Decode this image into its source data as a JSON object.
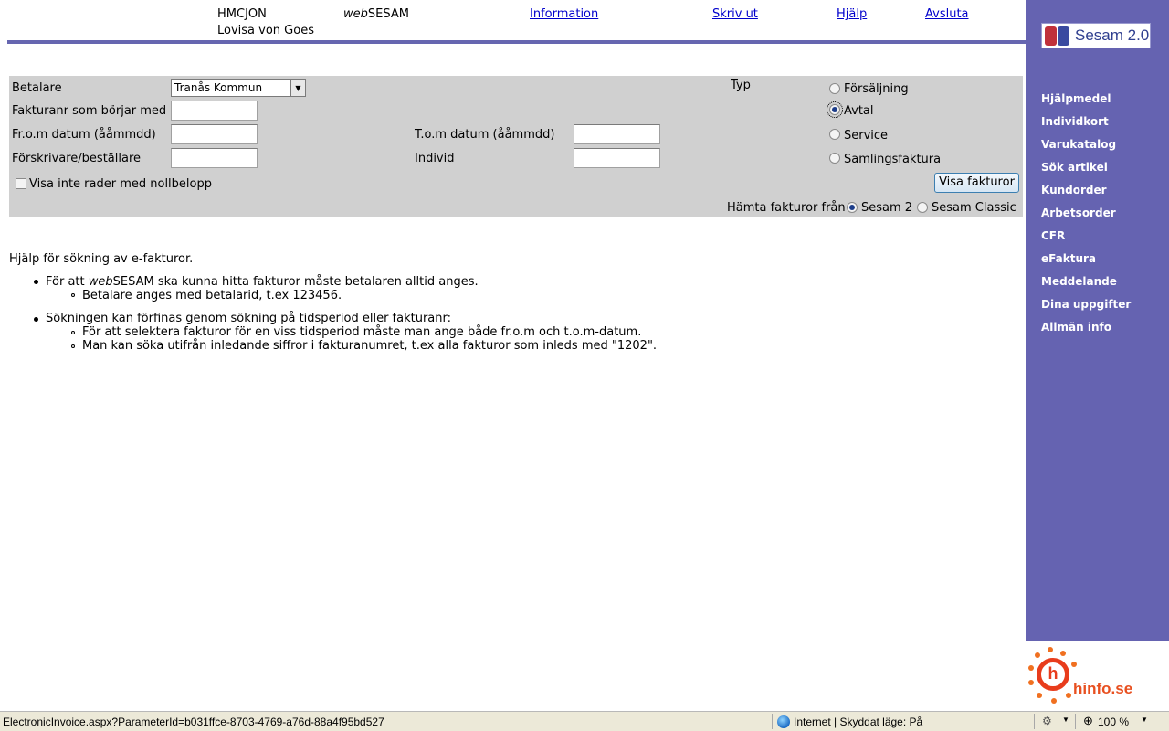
{
  "header": {
    "user_id": "HMCJON",
    "user_name": "Lovisa von Goes",
    "app_name_prefix": "web",
    "app_name_suffix": "SESAM",
    "links": {
      "information": "Information",
      "print": "Skriv ut",
      "help": "Hjälp",
      "logout": "Avsluta"
    }
  },
  "sidebar": {
    "logo_text": "Sesam 2.0",
    "items": [
      {
        "label": "Hjälpmedel"
      },
      {
        "label": "Individkort"
      },
      {
        "label": "Varukatalog"
      },
      {
        "label": "Sök artikel"
      },
      {
        "label": "Kundorder"
      },
      {
        "label": "Arbetsorder"
      },
      {
        "label": "CFR"
      },
      {
        "label": "eFaktura"
      },
      {
        "label": "Meddelande"
      },
      {
        "label": "Dina uppgifter"
      },
      {
        "label": "Allmän info"
      }
    ],
    "partner_logo": "hinfo.se"
  },
  "form": {
    "payer_label": "Betalare",
    "payer_value": "Tranås Kommun",
    "invoice_no_label": "Fakturanr som börjar med",
    "invoice_no_value": "",
    "from_date_label": "Fr.o.m datum (ååmmdd)",
    "from_date_value": "",
    "to_date_label": "T.o.m datum (ååmmdd)",
    "to_date_value": "",
    "prescriber_label": "Förskrivare/beställare",
    "prescriber_value": "",
    "individual_label": "Individ",
    "individual_value": "",
    "hide_zero_label": "Visa inte rader med nollbelopp",
    "hide_zero_checked": false,
    "type_label": "Typ",
    "type_options": [
      {
        "label": "Försäljning",
        "selected": false
      },
      {
        "label": "Avtal",
        "selected": true
      },
      {
        "label": "Service",
        "selected": false
      },
      {
        "label": "Samlingsfaktura",
        "selected": false
      }
    ],
    "show_button": "Visa fakturor",
    "fetch_from_label": "Hämta fakturor från",
    "fetch_from_options": [
      {
        "label": "Sesam 2",
        "selected": true
      },
      {
        "label": "Sesam Classic",
        "selected": false
      }
    ]
  },
  "help": {
    "title": "Hjälp för sökning av e-fakturor.",
    "bullet1_prefix": "För att ",
    "bullet1_brand": "web",
    "bullet1_rest": "SESAM ska kunna hitta fakturor måste betalaren alltid anges.",
    "bullet1_sub1": "Betalare anges med betalarid, t.ex 123456.",
    "bullet2": "Sökningen kan förfinas genom sökning på tidsperiod eller fakturanr:",
    "bullet2_sub1": "För att selektera fakturor för en viss tidsperiod måste man ange både fr.o.m och t.o.m-datum.",
    "bullet2_sub2": "Man kan söka utifrån inledande siffror i fakturanumret, t.ex alla fakturor som inleds med \"1202\"."
  },
  "statusbar": {
    "url": "ElectronicInvoice.aspx?ParameterId=b031ffce-8703-4769-a76d-88a4f95bd527",
    "zone": "Internet | Skyddat läge: På",
    "zoom": "100 %"
  }
}
